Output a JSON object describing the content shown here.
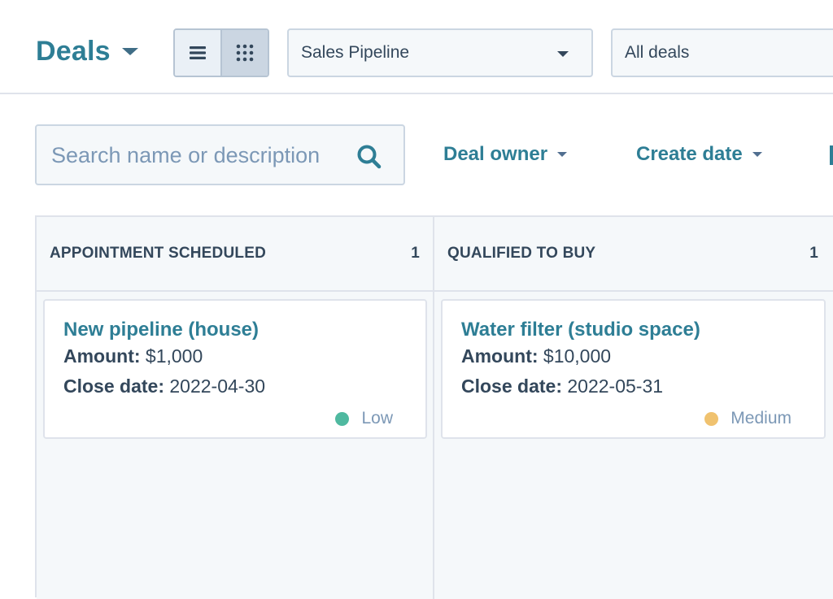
{
  "header": {
    "title": "Deals",
    "view_toggle": {
      "list_icon": "list-view-icon",
      "board_icon": "board-view-icon",
      "active": "board"
    },
    "pipeline_select": "Sales Pipeline",
    "deal_filter_select": "All deals"
  },
  "toolbar": {
    "search_placeholder": "Search name or description",
    "search_icon": "search-icon",
    "filters": [
      "Deal owner",
      "Create date"
    ]
  },
  "board": {
    "columns": [
      {
        "title": "APPOINTMENT SCHEDULED",
        "count": "1",
        "cards": [
          {
            "name": "New pipeline (house)",
            "amount_label": "Amount:",
            "amount": "$1,000",
            "close_label": "Close date:",
            "close_date": "2022-04-30",
            "priority": "Low",
            "priority_color": "#4fb9a0"
          }
        ]
      },
      {
        "title": "QUALIFIED TO BUY",
        "count": "1",
        "cards": [
          {
            "name": "Water filter (studio space)",
            "amount_label": "Amount:",
            "amount": "$10,000",
            "close_label": "Close date:",
            "close_date": "2022-05-31",
            "priority": "Medium",
            "priority_color": "#f0c26f"
          }
        ]
      }
    ]
  },
  "colors": {
    "accent": "#2e7e95",
    "text": "#33475b",
    "muted": "#7c98b6",
    "border": "#dfe3eb",
    "column_bg": "#f5f8fa"
  }
}
